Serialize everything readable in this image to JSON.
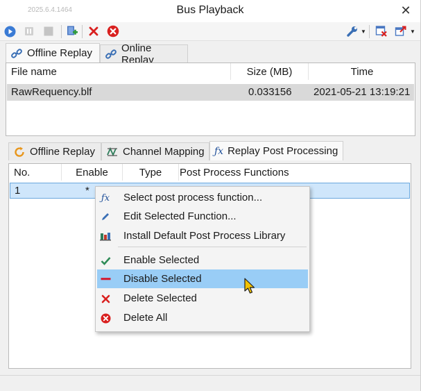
{
  "window": {
    "version": "2025.6.4.1464",
    "title": "Bus Playback",
    "close_glyph": "✕"
  },
  "toolbar": {
    "icons": [
      "play-icon",
      "pause-icon",
      "stop-icon",
      "add-file-icon",
      "delete-icon",
      "clear-all-icon",
      "settings-icon",
      "close-file-icon",
      "export-icon"
    ]
  },
  "top_tabs": [
    {
      "label": "Offline Replay",
      "icon": "link-icon",
      "active": true
    },
    {
      "label": "Online Replay",
      "icon": "link-icon",
      "active": false
    }
  ],
  "file_table": {
    "columns": [
      "File name",
      "Size (MB)",
      "Time"
    ],
    "rows": [
      {
        "file_name": "RawRequency.blf",
        "size": "0.033156",
        "time": "2021-05-21 13:19:21"
      }
    ]
  },
  "bottom_tabs": [
    {
      "label": "Offline Replay",
      "icon": "loop-icon",
      "active": false
    },
    {
      "label": "Channel Mapping",
      "icon": "mapping-icon",
      "active": false
    },
    {
      "label": "Replay Post Processing",
      "icon": "fx-icon",
      "active": true
    }
  ],
  "post_table": {
    "columns": [
      "No.",
      "Enable",
      "Type",
      "Post Process Functions"
    ],
    "rows": [
      {
        "no": "1",
        "enable": "*",
        "type": "",
        "functions": ""
      }
    ]
  },
  "context_menu": {
    "items": [
      {
        "label": "Select post process function...",
        "icon": "fx-icon"
      },
      {
        "label": "Edit Selected Function...",
        "icon": "pencil-icon"
      },
      {
        "label": "Install Default Post Process Library",
        "icon": "library-icon"
      },
      {
        "label": "Enable Selected",
        "icon": "check-icon"
      },
      {
        "label": "Disable Selected",
        "icon": "minus-icon",
        "highlighted": true
      },
      {
        "label": "Delete Selected",
        "icon": "x-icon"
      },
      {
        "label": "Delete All",
        "icon": "delete-all-icon"
      }
    ]
  },
  "colors": {
    "accent_blue": "#3a7bd5",
    "selection": "#99cdf6",
    "row_selected_gray": "#d9d9d9",
    "delete_red": "#d9201f",
    "check_green": "#2e8b57"
  }
}
